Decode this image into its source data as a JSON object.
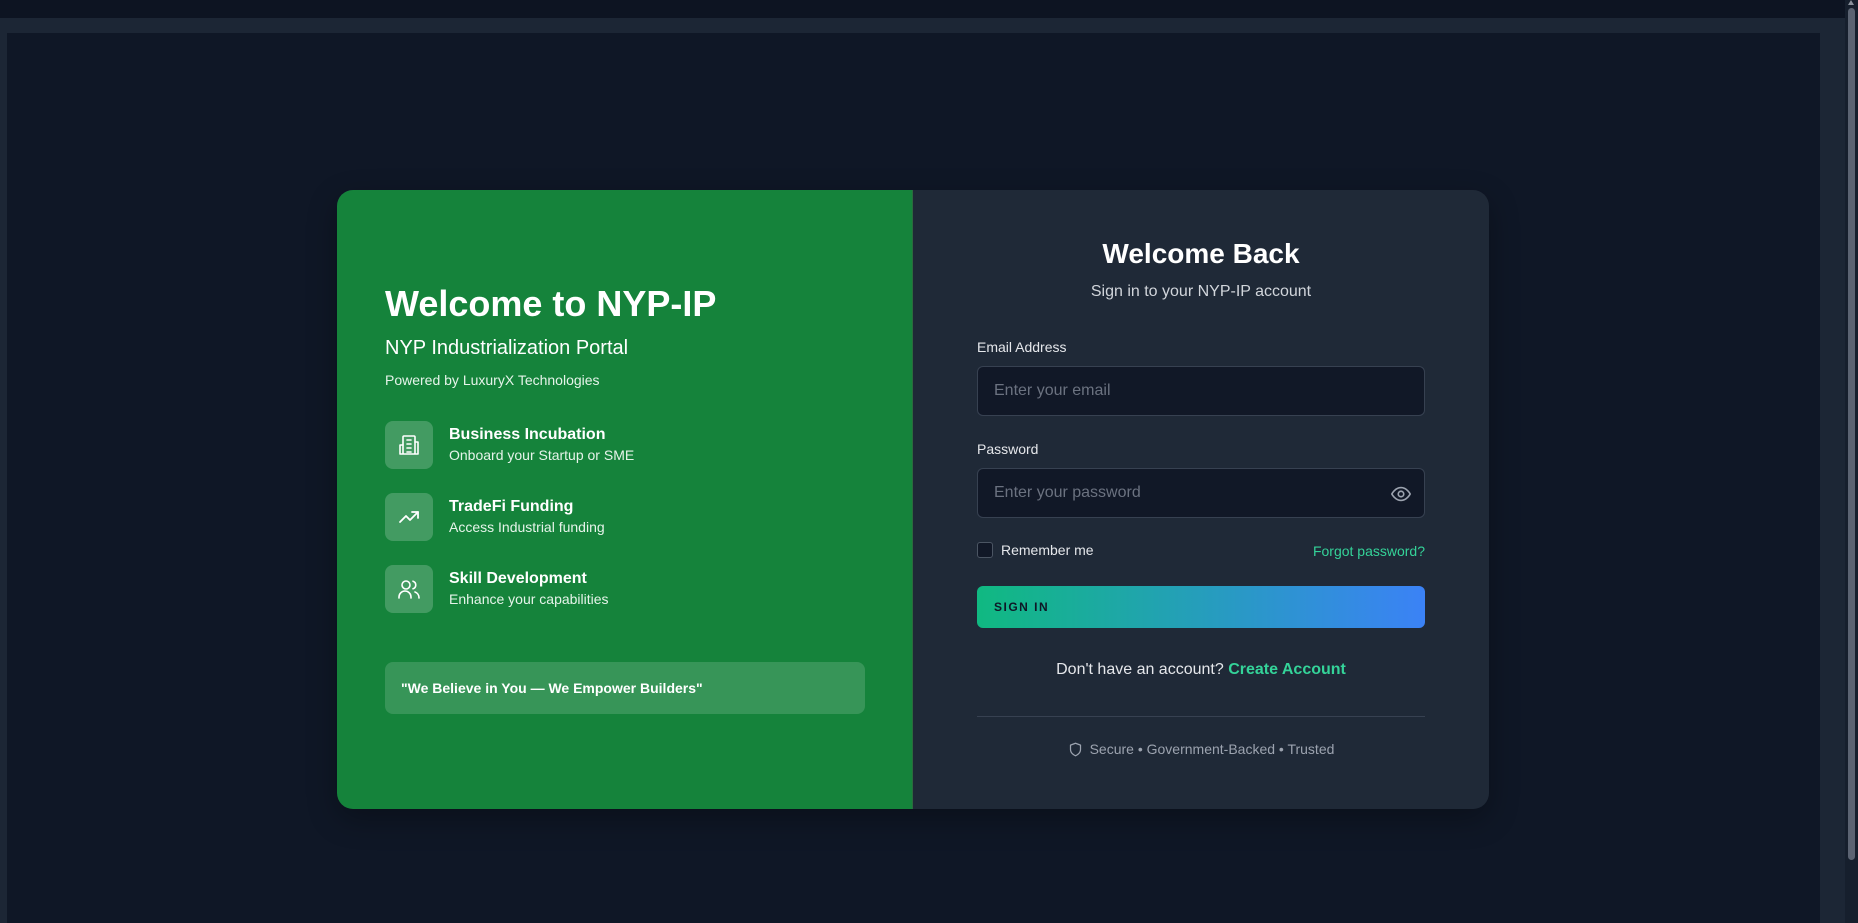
{
  "brand": {
    "title": "Welcome to NYP-IP",
    "subtitle": "NYP Industrialization Portal",
    "powered_by": "Powered by LuxuryX Technologies"
  },
  "features": [
    {
      "icon": "building-icon",
      "title": "Business Incubation",
      "description": "Onboard your Startup or SME"
    },
    {
      "icon": "trending-up-icon",
      "title": "TradeFi Funding",
      "description": "Access Industrial funding"
    },
    {
      "icon": "users-icon",
      "title": "Skill Development",
      "description": "Enhance your capabilities"
    }
  ],
  "quote": "\"We Believe in You — We Empower Builders\"",
  "login": {
    "title": "Welcome Back",
    "subtitle": "Sign in to your NYP-IP account",
    "email_label": "Email Address",
    "email_placeholder": "Enter your email",
    "email_value": "",
    "password_label": "Password",
    "password_placeholder": "Enter your password",
    "password_value": "",
    "remember_label": "Remember me",
    "remember_checked": false,
    "forgot_label": "Forgot password?",
    "signin_label": "SIGN IN",
    "no_account_text": "Don't have an account?",
    "create_account_label": "Create Account",
    "trust_text": "Secure • Government-Backed • Trusted"
  },
  "colors": {
    "left_panel": "#15833b",
    "right_panel": "#1f2937",
    "accent": "#34d399",
    "button_gradient_start": "#10b981",
    "button_gradient_end": "#3b82f6",
    "page_background": "#0f1726"
  }
}
